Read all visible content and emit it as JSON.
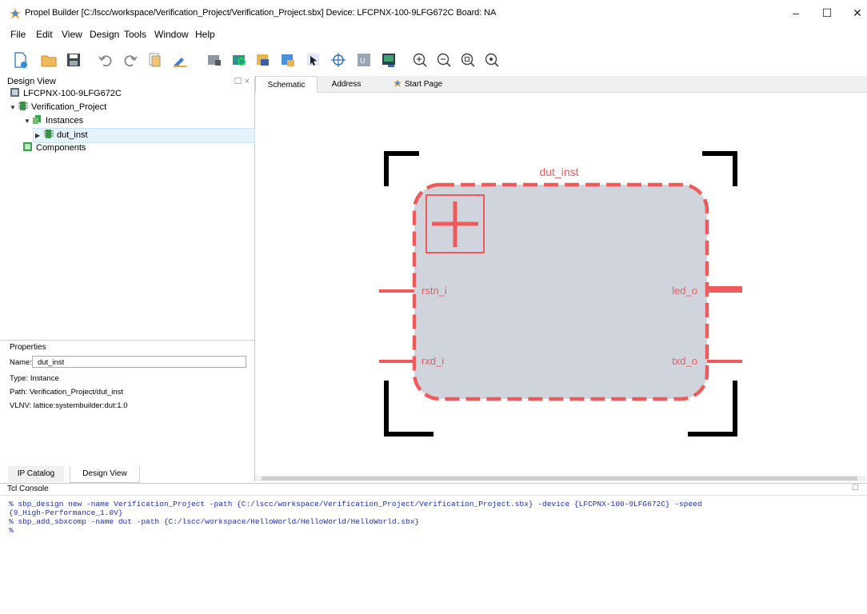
{
  "window": {
    "title": "Propel Builder  [C:/lscc/workspace/Verification_Project/Verification_Project.sbx]  Device: LFCPNX-100-9LFG672C  Board: NA",
    "controls": [
      "–",
      "☐",
      "✕"
    ]
  },
  "menu": [
    "File",
    "Edit",
    "View",
    "Design",
    "Tools",
    "Window",
    "Help"
  ],
  "toolbar": {
    "icons": [
      "new-file-icon",
      "open-folder-icon",
      "save-icon",
      "undo-icon",
      "redo-icon",
      "copy-icon",
      "pencil-icon",
      "module-icon",
      "run-icon",
      "connect-icon",
      "add-block-icon",
      "select-icon",
      "crosshair-icon",
      "generate-icon",
      "terminal-icon",
      "zoom-in-icon",
      "zoom-out-icon",
      "zoom-fit-icon",
      "zoom-area-icon"
    ]
  },
  "design_view": {
    "title": "Design View",
    "tree": {
      "device": "LFCPNX-100-9LFG672C",
      "project": "Verification_Project",
      "instances": "Instances",
      "instance_item": "dut_inst",
      "components": "Components"
    }
  },
  "properties": {
    "title": "Properties",
    "name_label": "Name:",
    "name_value": "dut_inst",
    "type": "Type:  Instance",
    "path": "Path:  Verification_Project/dut_inst",
    "vlnv": "VLNV:  lattice:systembuilder:dut:1.0"
  },
  "bottom_tabs": [
    "IP Catalog",
    "Design View"
  ],
  "editor_tabs": [
    "Schematic",
    "Address",
    "Start Page"
  ],
  "schematic": {
    "block_name": "dut_inst",
    "ports_left": [
      "rstn_i",
      "rxd_i"
    ],
    "ports_right": [
      "led_o",
      "txd_o"
    ],
    "color_accent": "#f05a5a",
    "color_fill": "#d0d5dd"
  },
  "tcl_console": {
    "title": "Tcl Console",
    "lines": [
      "% sbp_design new -name Verification_Project -path {C:/lscc/workspace/Verification_Project/Verification_Project.sbx} -device {LFCPNX-100-9LFG672C} -speed",
      "{9_High-Performance_1.0V}",
      "% sbp_add_sbxcomp -name dut -path {C:/lscc/workspace/HelloWorld/HelloWorld/HelloWorld.sbx}",
      "%"
    ]
  }
}
